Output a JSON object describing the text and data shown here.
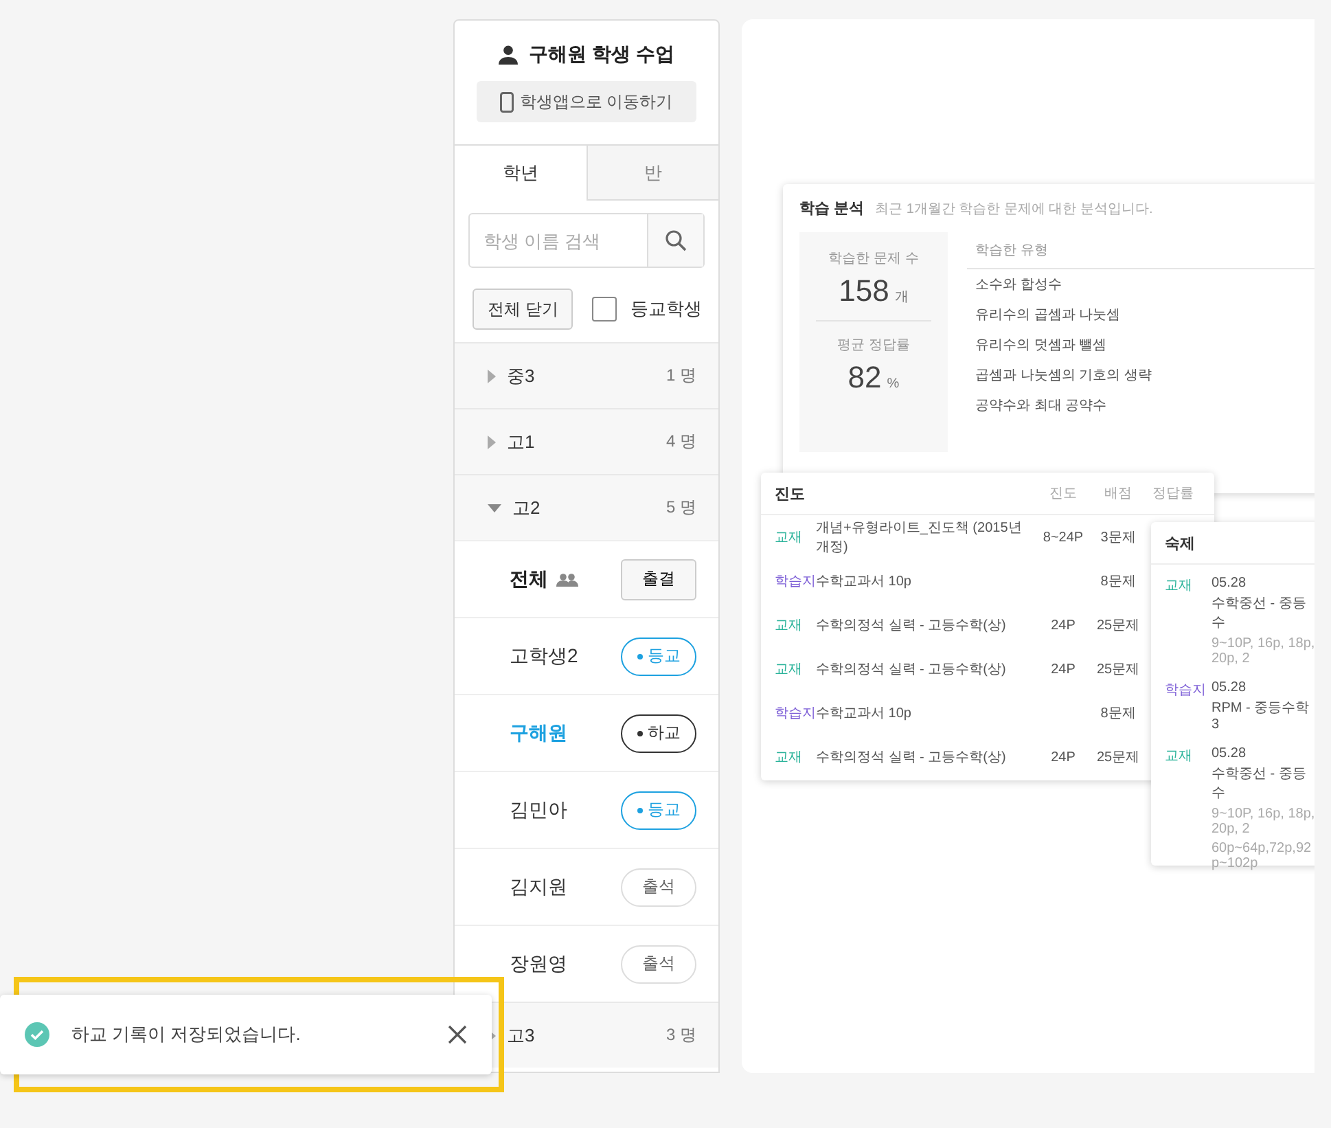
{
  "sidebar": {
    "title": "구해원 학생 수업",
    "app_button": "학생앱으로 이동하기",
    "tabs": [
      {
        "label": "학년",
        "selected": true
      },
      {
        "label": "반",
        "selected": false
      }
    ],
    "search": {
      "placeholder": "학생 이름 검색"
    },
    "collapse_button": "전체 닫기",
    "filter": {
      "label": "등교학생",
      "checked": false
    },
    "groups": [
      {
        "name": "중3",
        "count": "1 명",
        "expanded": false
      },
      {
        "name": "고1",
        "count": "4 명",
        "expanded": false
      },
      {
        "name": "고2",
        "count": "5 명",
        "expanded": true,
        "all_row": {
          "label": "전체",
          "button": "출결"
        },
        "children": [
          {
            "name": "고학생2",
            "status": "등교",
            "kind": "arrived",
            "selected": false
          },
          {
            "name": "구해원",
            "status": "하교",
            "kind": "left",
            "selected": true
          },
          {
            "name": "김민아",
            "status": "등교",
            "kind": "arrived",
            "selected": false
          },
          {
            "name": "김지원",
            "status": "출석",
            "kind": "present",
            "selected": false
          },
          {
            "name": "장원영",
            "status": "출석",
            "kind": "present",
            "selected": false
          }
        ]
      },
      {
        "name": "고3",
        "count": "3 명",
        "expanded": false
      }
    ]
  },
  "preview": {
    "analysis_card": {
      "title": "학습 분석",
      "subtitle": "최근 1개월간 학습한 문제에 대한 분석입니다.",
      "stats": [
        {
          "label": "학습한 문제 수",
          "value": "158",
          "unit": "개"
        },
        {
          "label": "평균 정답률",
          "value": "82",
          "unit": "%"
        }
      ],
      "types_header": "학습한 유형",
      "types": [
        "소수와 합성수",
        "유리수의 곱셈과 나눗셈",
        "유리수의 덧셈과 뺄셈",
        "곱셈과 나눗셈의 기호의 생략",
        "공약수와 최대 공약수"
      ]
    },
    "progress_card": {
      "title": "진도",
      "columns": [
        "진도",
        "배점",
        "정답률"
      ],
      "rows": [
        {
          "tag": "교재",
          "kind": "textbook",
          "name": "개념+유형라이트_진도책 (2015년 개정)",
          "range": "8~24P",
          "score": "3문제"
        },
        {
          "tag": "학습지",
          "kind": "worksheet",
          "name": "수학교과서 10p",
          "score": "8문제"
        },
        {
          "tag": "교재",
          "kind": "textbook",
          "name": "수학의정석 실력 - 고등수학(상)",
          "range": "24P",
          "score": "25문제"
        },
        {
          "tag": "교재",
          "kind": "textbook",
          "name": "수학의정석 실력 - 고등수학(상)",
          "range": "24P",
          "score": "25문제"
        },
        {
          "tag": "학습지",
          "kind": "worksheet",
          "name": "수학교과서 10p",
          "score": "8문제"
        },
        {
          "tag": "교재",
          "kind": "textbook",
          "name": "수학의정석 실력 - 고등수학(상)",
          "range": "24P",
          "score": "25문제"
        }
      ]
    },
    "homework_card": {
      "title": "숙제",
      "rows": [
        {
          "tag": "교재",
          "kind": "textbook",
          "date": "05.28",
          "name": "수학중선 - 중등수",
          "details": [
            "9~10P, 16p, 18p, 20p, 2"
          ]
        },
        {
          "tag": "학습지",
          "kind": "worksheet",
          "date": "05.28",
          "name": "RPM - 중등수학3"
        },
        {
          "tag": "교재",
          "kind": "textbook",
          "date": "05.28",
          "name": "수학중선 - 중등수",
          "details": [
            "9~10P, 16p, 18p, 20p, 2",
            "60p~64p,72p,92p~102p"
          ]
        }
      ]
    }
  },
  "toast": {
    "kind": "success",
    "message": "하교 기록이 저장되었습니다."
  }
}
